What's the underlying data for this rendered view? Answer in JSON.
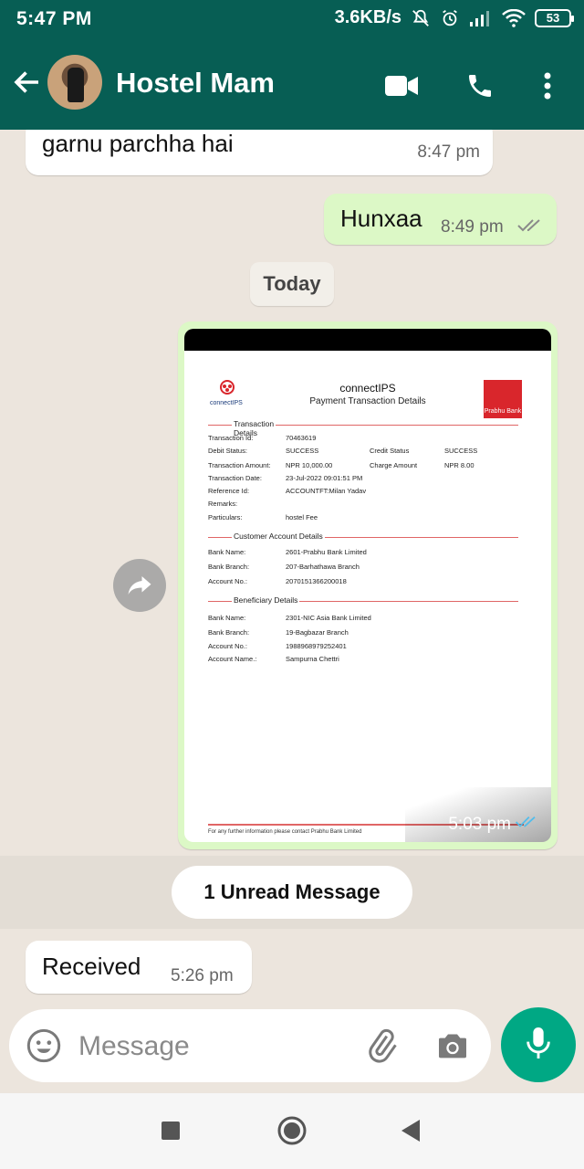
{
  "status_bar": {
    "time": "5:47 PM",
    "speed": "3.6KB/s",
    "battery": "53",
    "icons": [
      "bell-off-icon",
      "alarm-icon",
      "signal-icon",
      "wifi-icon",
      "battery-icon"
    ]
  },
  "header": {
    "contact_name": "Hostel Mam",
    "icons": [
      "back-arrow-icon",
      "video-call-icon",
      "voice-call-icon",
      "more-vert-icon"
    ]
  },
  "messages": [
    {
      "direction": "incoming",
      "text": "garnu parchha hai",
      "time": "8:47 pm"
    },
    {
      "direction": "outgoing",
      "text": "Hunxaa",
      "time": "8:49 pm",
      "ticks": "read-grey"
    }
  ],
  "day_separator": "Today",
  "image_message": {
    "time": "5:03 pm",
    "receipt": {
      "title": "connectIPS",
      "subtitle": "Payment Transaction Details",
      "logo_left": "connectIPS",
      "logo_right": "Prabhu Bank",
      "sections": [
        {
          "heading": "Transaction Details",
          "rows": [
            {
              "label": "Transaction Id:",
              "value": "70463619"
            },
            {
              "label": "Debit Status:",
              "value": "SUCCESS",
              "label2": "Credit Status",
              "value2": "SUCCESS"
            },
            {
              "label": "Transaction Amount:",
              "value": "NPR 10,000.00",
              "label2": "Charge Amount",
              "value2": "NPR 8.00"
            },
            {
              "label": "Transaction Date:",
              "value": "23-Jul-2022 09:01:51 PM"
            },
            {
              "label": "Reference Id:",
              "value": "ACCOUNTFT:Milan Yadav"
            },
            {
              "label": "Remarks:",
              "value": ""
            },
            {
              "label": "Particulars:",
              "value": "hostel Fee"
            }
          ]
        },
        {
          "heading": "Customer Account Details",
          "rows": [
            {
              "label": "Bank Name:",
              "value": "2601-Prabhu Bank Limited"
            },
            {
              "label": "Bank Branch:",
              "value": "207-Barhathawa Branch"
            },
            {
              "label": "Account No.:",
              "value": "2070151366200018"
            }
          ]
        },
        {
          "heading": "Beneficiary Details",
          "rows": [
            {
              "label": "Bank Name:",
              "value": "2301-NIC Asia Bank Limited"
            },
            {
              "label": "Bank Branch:",
              "value": "19-Bagbazar Branch"
            },
            {
              "label": "Account No.:",
              "value": "1988968979252401"
            },
            {
              "label": "Account Name.:",
              "value": "Sampurna Chettri"
            }
          ]
        }
      ],
      "footer": "For any further information please contact Prabhu Bank Limited"
    }
  },
  "unread_banner": "1 Unread Message",
  "received_message": {
    "direction": "incoming",
    "text": "Received",
    "time": "5:26 pm"
  },
  "composer": {
    "placeholder": "Message",
    "icons": [
      "emoji-icon",
      "attach-icon",
      "camera-icon",
      "mic-icon"
    ]
  },
  "nav": {
    "icons": [
      "recents-icon",
      "home-icon",
      "back-icon"
    ]
  },
  "colors": {
    "header": "#075e54",
    "outgoing": "#dcf8c6",
    "accent": "#00a884",
    "tick_read": "#53bdeb"
  }
}
